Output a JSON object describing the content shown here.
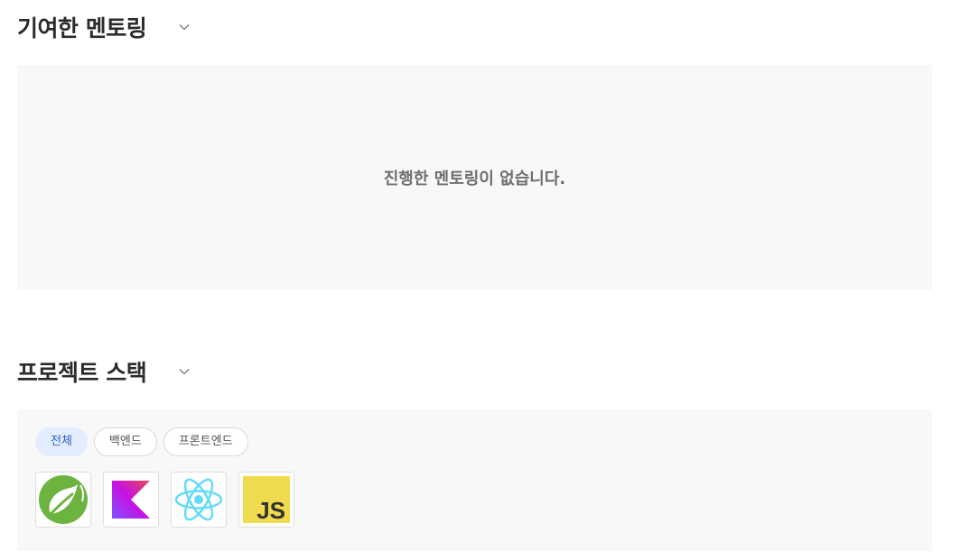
{
  "mentoring": {
    "title": "기여한 멘토링",
    "empty_message": "진행한 멘토링이 없습니다."
  },
  "stack": {
    "title": "프로젝트 스택",
    "filters": [
      {
        "label": "전체",
        "active": true
      },
      {
        "label": "백엔드",
        "active": false
      },
      {
        "label": "프론트엔드",
        "active": false
      }
    ],
    "technologies": [
      {
        "icon": "spring-icon"
      },
      {
        "icon": "kotlin-icon"
      },
      {
        "icon": "react-icon"
      },
      {
        "icon": "javascript-icon",
        "text": "JS"
      }
    ]
  },
  "colors": {
    "panel_bg": "#f8f8f8",
    "active_chip_bg": "#e3edfd",
    "active_chip_text": "#2f63c4",
    "spring_green": "#6db33f",
    "react_cyan": "#61dafb",
    "js_yellow": "#f0db4f"
  }
}
